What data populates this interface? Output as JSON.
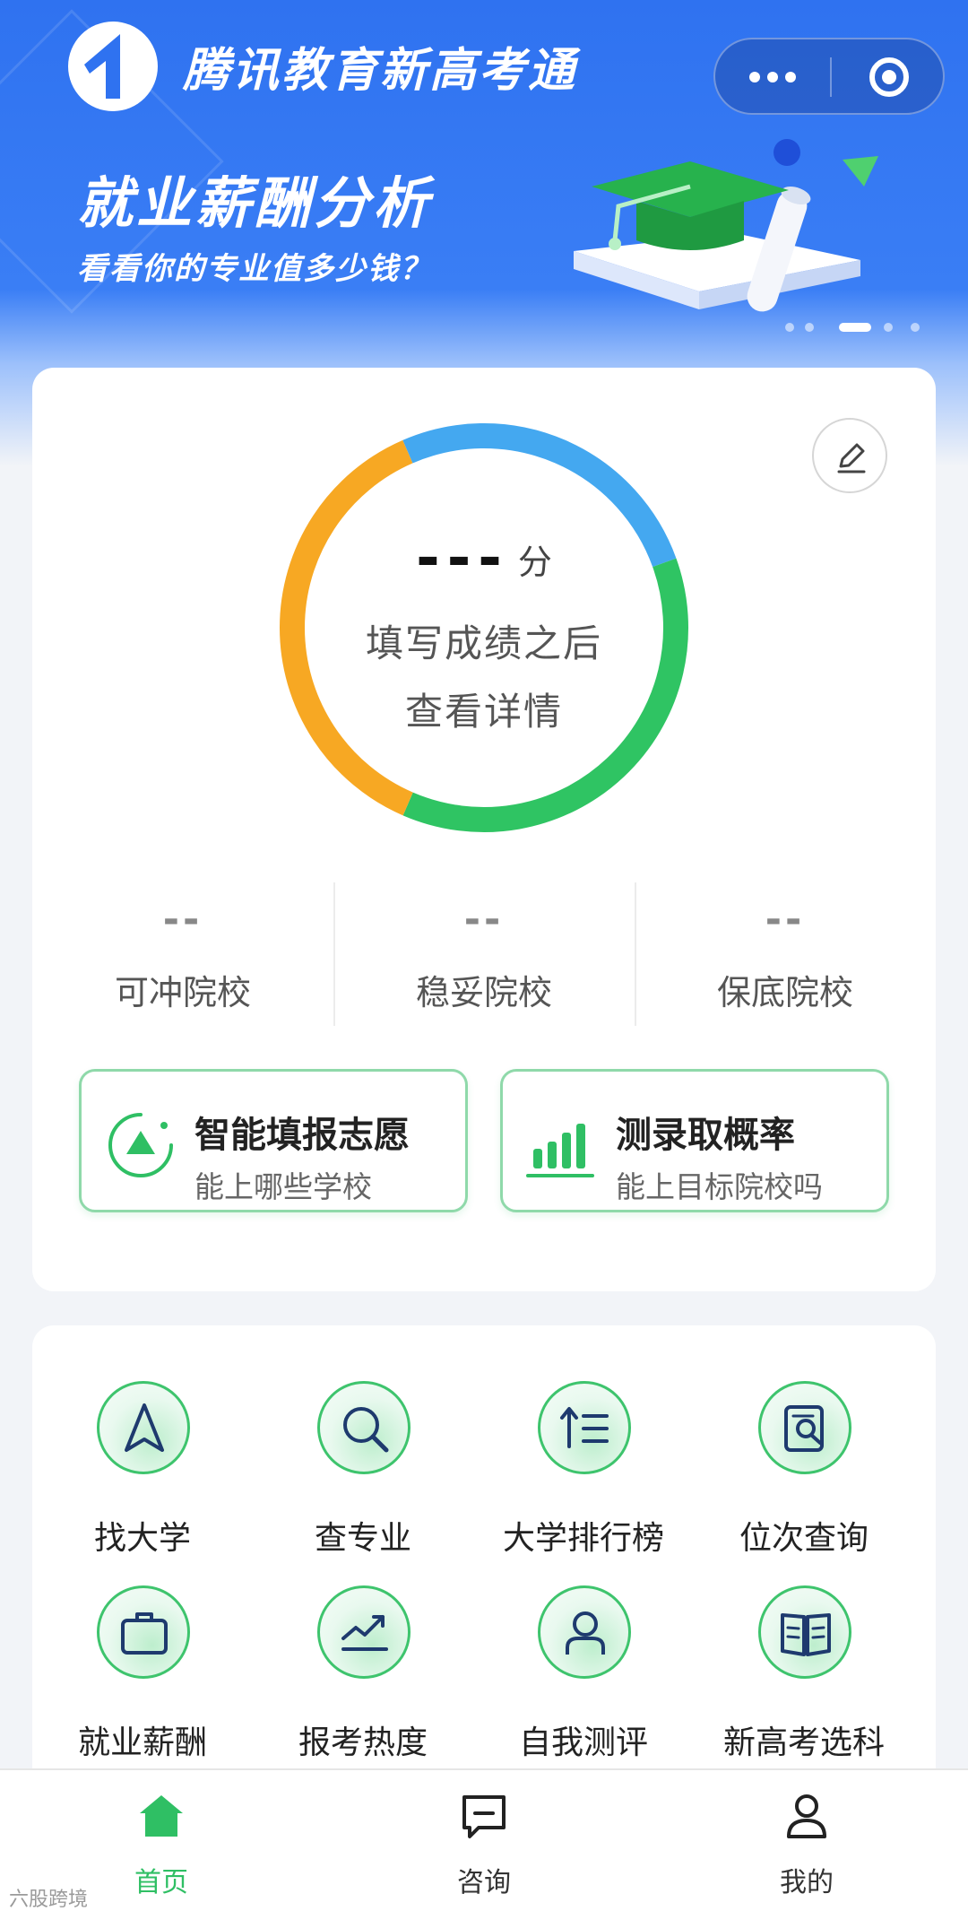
{
  "header": {
    "app_title": "腾讯教育新高考通",
    "menu_button": "more-dots",
    "close_button": "target-circle"
  },
  "banner": {
    "title": "就业薪酬分析",
    "subtitle": "看看你的专业值多少钱？",
    "carousel": {
      "count": 5,
      "active_index": 3
    }
  },
  "score_card": {
    "score_value": "---",
    "score_unit": "分",
    "hint_line1": "填写成绩之后",
    "hint_line2": "查看详情",
    "ring_colors": {
      "blue": "#44a8f0",
      "green": "#2fc463",
      "orange": "#f7a823"
    },
    "ring_segments": [
      {
        "color": "blue",
        "fraction": 0.26
      },
      {
        "color": "green",
        "fraction": 0.37
      },
      {
        "color": "orange",
        "fraction": 0.37
      }
    ],
    "stats": [
      {
        "value": "--",
        "label": "可冲院校"
      },
      {
        "value": "--",
        "label": "稳妥院校"
      },
      {
        "value": "--",
        "label": "保底院校"
      }
    ],
    "actions": [
      {
        "title": "智能填报志愿",
        "subtitle": "能上哪些学校",
        "icon": "triangle-target-icon"
      },
      {
        "title": "测录取概率",
        "subtitle": "能上目标院校吗",
        "icon": "bar-chart-icon"
      }
    ]
  },
  "tools": [
    {
      "label": "找大学",
      "icon": "navigation-arrow-icon"
    },
    {
      "label": "查专业",
      "icon": "search-icon"
    },
    {
      "label": "大学排行榜",
      "icon": "ranking-list-icon"
    },
    {
      "label": "位次查询",
      "icon": "document-search-icon"
    },
    {
      "label": "就业薪酬",
      "icon": "briefcase-icon"
    },
    {
      "label": "报考热度",
      "icon": "trend-chart-icon"
    },
    {
      "label": "自我测评",
      "icon": "person-icon"
    },
    {
      "label": "新高考选科",
      "icon": "book-icon"
    }
  ],
  "tabbar": {
    "items": [
      {
        "label": "首页",
        "icon": "home-icon",
        "active": true
      },
      {
        "label": "咨询",
        "icon": "chat-icon",
        "active": false
      },
      {
        "label": "我的",
        "icon": "user-icon",
        "active": false
      }
    ]
  },
  "watermark": "六股跨境",
  "colors": {
    "primary_blue": "#3277f2",
    "accent_green": "#2fbf64",
    "text_dark": "#222222"
  }
}
